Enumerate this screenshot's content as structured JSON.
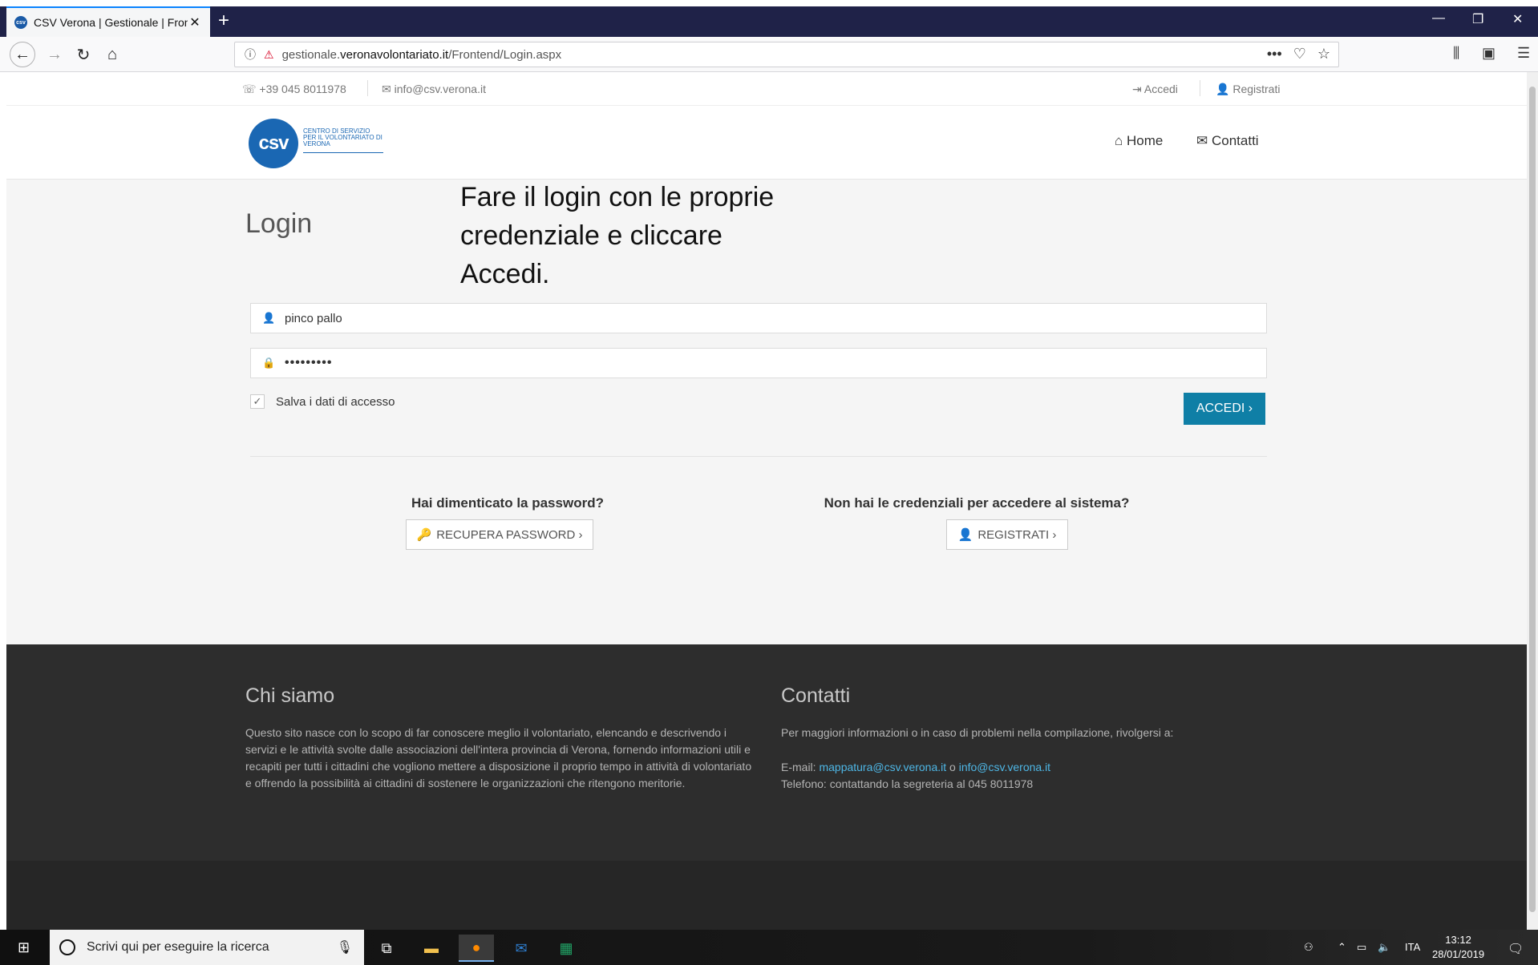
{
  "browser": {
    "tab_title": "CSV Verona | Gestionale | Fronte",
    "url_prefix": "gestionale.",
    "url_domain": "veronavolontariato.it",
    "url_path": "/Frontend/Login.aspx"
  },
  "topbar": {
    "phone": "+39 045 8011978",
    "email": "info@csv.verona.it",
    "login_link": "Accedi",
    "register_link": "Registrati"
  },
  "header": {
    "logo_mark": "csv",
    "logo_text": "CENTRO DI SERVIZIO PER IL VOLONTARIATO DI VERONA",
    "nav_home": "Home",
    "nav_contacts": "Contatti"
  },
  "annotation": "Fare il login con le proprie credenziale e cliccare Accedi.",
  "login": {
    "title": "Login",
    "username_value": "pinco pallo",
    "password_value": "•••••••••",
    "remember_label": "Salva i dati di accesso",
    "submit_label": "ACCEDI ›"
  },
  "help": {
    "forgot_question": "Hai dimenticato la password?",
    "forgot_button": "RECUPERA PASSWORD ›",
    "no_credentials_question": "Non hai le credenziali per accedere al sistema?",
    "register_button": "REGISTRATI ›"
  },
  "footer": {
    "about_title": "Chi siamo",
    "about_text": "Questo sito nasce con lo scopo di far conoscere meglio il volontariato, elencando e descrivendo i servizi e le attività svolte dalle associazioni dell'intera provincia di Verona, fornendo informazioni utili e recapiti per tutti i cittadini che vogliono mettere a disposizione il proprio tempo in attività di volontariato e offrendo la possibilità ai cittadini di sostenere le organizzazioni che ritengono meritorie.",
    "contacts_title": "Contatti",
    "contacts_intro": "Per maggiori informazioni o in caso di problemi nella compilazione, rivolgersi a:",
    "email_label": "E-mail:",
    "email_1": "mappatura@csv.verona.it",
    "email_or": "o",
    "email_2": "info@csv.verona.it",
    "phone_text": "Telefono: contattando la segreteria al 045 8011978"
  },
  "taskbar": {
    "search_placeholder": "Scrivi qui per eseguire la ricerca",
    "language": "ITA",
    "time": "13:12",
    "date": "28/01/2019"
  }
}
